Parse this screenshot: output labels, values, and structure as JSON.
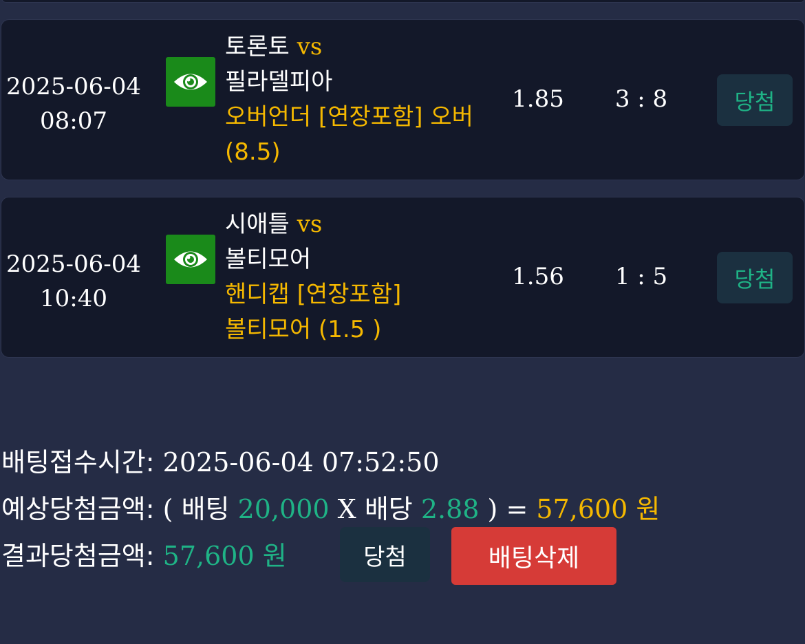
{
  "bets": [
    {
      "date": "2025-06-04",
      "time": "08:07",
      "home_team": "토론토",
      "vs_label": "vs",
      "away_team": "필라델피아",
      "pick": "오버언더 [연장포함] 오버 (8.5)",
      "odds": "1.85",
      "score": "3 : 8",
      "status": "당첨"
    },
    {
      "date": "2025-06-04",
      "time": "10:40",
      "home_team": "시애틀",
      "vs_label": "vs",
      "away_team": "볼티모어",
      "pick_line1": "핸디캡 [연장포함]",
      "pick_line2": "볼티모어 (1.5 )",
      "odds": "1.56",
      "score": "1 : 5",
      "status": "당첨"
    }
  ],
  "summary": {
    "bet_time_label": "배팅접수시간:",
    "bet_time_value": "2025-06-04 07:52:50",
    "expected_label": "예상당첨금액:",
    "expected_open": "(",
    "bet_word": "배팅",
    "bet_amount": "20,000",
    "times": "X",
    "odds_word": "배당",
    "total_odds": "2.88",
    "expected_close": ") =",
    "expected_amount": "57,600 원",
    "result_label": "결과당첨금액:",
    "result_amount": "57,600 원",
    "result_status_button": "당첨",
    "delete_button": "배팅삭제"
  },
  "icons": {
    "view": "eye-icon"
  },
  "colors": {
    "background": "#252c45",
    "card": "#131829",
    "accent_yellow": "#f5b800",
    "accent_green": "#1fb386",
    "eye_button": "#1a8a1a",
    "delete_button": "#d63b37"
  }
}
